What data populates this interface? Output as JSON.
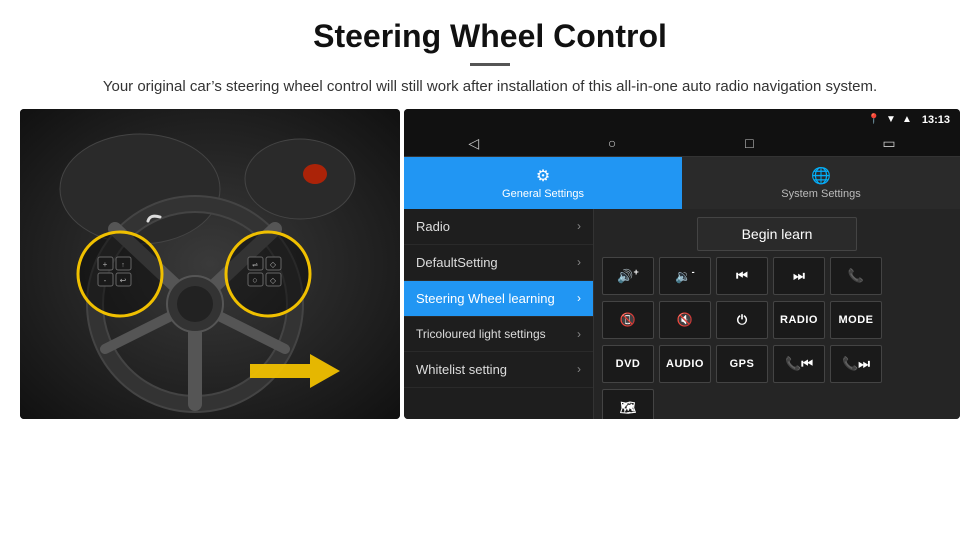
{
  "header": {
    "title": "Steering Wheel Control",
    "divider": true,
    "subtitle": "Your original car’s steering wheel control will still work after installation of this all-in-one auto radio navigation system."
  },
  "status_bar": {
    "time": "13:13",
    "icons": [
      "location",
      "wifi",
      "signal"
    ]
  },
  "nav_bar": {
    "icons": [
      "back",
      "home",
      "square",
      "media"
    ]
  },
  "tabs": [
    {
      "id": "general",
      "label": "General Settings",
      "icon": "⚙",
      "active": true
    },
    {
      "id": "system",
      "label": "System Settings",
      "icon": "🌐",
      "active": false
    }
  ],
  "menu_items": [
    {
      "id": "radio",
      "label": "Radio",
      "active": false
    },
    {
      "id": "default",
      "label": "DefaultSetting",
      "active": false
    },
    {
      "id": "steering",
      "label": "Steering Wheel learning",
      "active": true
    },
    {
      "id": "tricolour",
      "label": "Tricoloured light settings",
      "active": false
    },
    {
      "id": "whitelist",
      "label": "Whitelist setting",
      "active": false
    }
  ],
  "right_panel": {
    "begin_learn_label": "Begin learn",
    "controls": [
      [
        {
          "id": "vol_up",
          "label": "🔊+",
          "type": "icon"
        },
        {
          "id": "vol_down",
          "label": "🔉-",
          "type": "icon"
        },
        {
          "id": "prev_track",
          "label": "⏮",
          "type": "icon"
        },
        {
          "id": "next_track",
          "label": "⏭",
          "type": "icon"
        },
        {
          "id": "call",
          "label": "📞",
          "type": "icon"
        }
      ],
      [
        {
          "id": "hang_up",
          "label": "📵",
          "type": "icon"
        },
        {
          "id": "mute",
          "label": "🔇",
          "type": "icon"
        },
        {
          "id": "power",
          "label": "⏻",
          "type": "icon"
        },
        {
          "id": "radio_btn",
          "label": "RADIO",
          "type": "text"
        },
        {
          "id": "mode_btn",
          "label": "MODE",
          "type": "text"
        }
      ],
      [
        {
          "id": "dvd_btn",
          "label": "DVD",
          "type": "text"
        },
        {
          "id": "audio_btn",
          "label": "AUDIO",
          "type": "text"
        },
        {
          "id": "gps_btn",
          "label": "GPS",
          "type": "text"
        },
        {
          "id": "tel_prev",
          "label": "📞⏮",
          "type": "icon"
        },
        {
          "id": "tel_next",
          "label": "📞⏭",
          "type": "icon"
        }
      ],
      [
        {
          "id": "nav_btn",
          "label": "🗺",
          "type": "icon"
        }
      ]
    ]
  }
}
